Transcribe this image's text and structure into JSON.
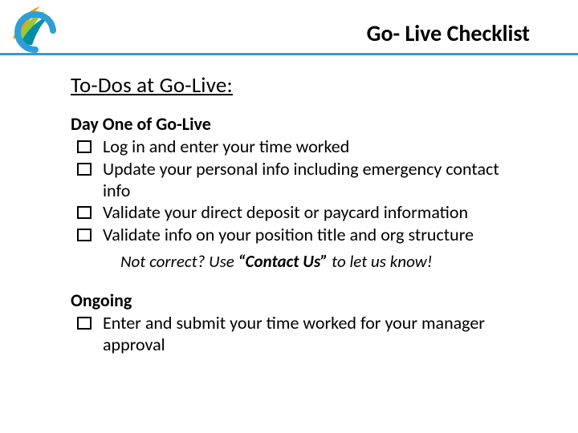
{
  "header": {
    "title": "Go- Live Checklist"
  },
  "section_title": "To-Dos at Go-Live:",
  "day_one": {
    "heading": "Day One of Go-Live",
    "items": [
      "Log in and enter your time worked",
      "Update your personal info including emergency contact info",
      "Validate your direct deposit or paycard information",
      "Validate info on your position title and org structure"
    ],
    "note_prefix": "Not correct?  Use ",
    "note_quote_l": "“",
    "note_emph": "Contact Us",
    "note_quote_r": "”",
    "note_suffix": " to let us know!"
  },
  "ongoing": {
    "heading": "Ongoing",
    "items": [
      "Enter and submit your time worked for your manager approval"
    ]
  },
  "logo": {
    "colors": {
      "teal": "#008fa0",
      "orange": "#f5a300",
      "blue": "#2e9ed6",
      "green": "#9ac83c"
    }
  }
}
